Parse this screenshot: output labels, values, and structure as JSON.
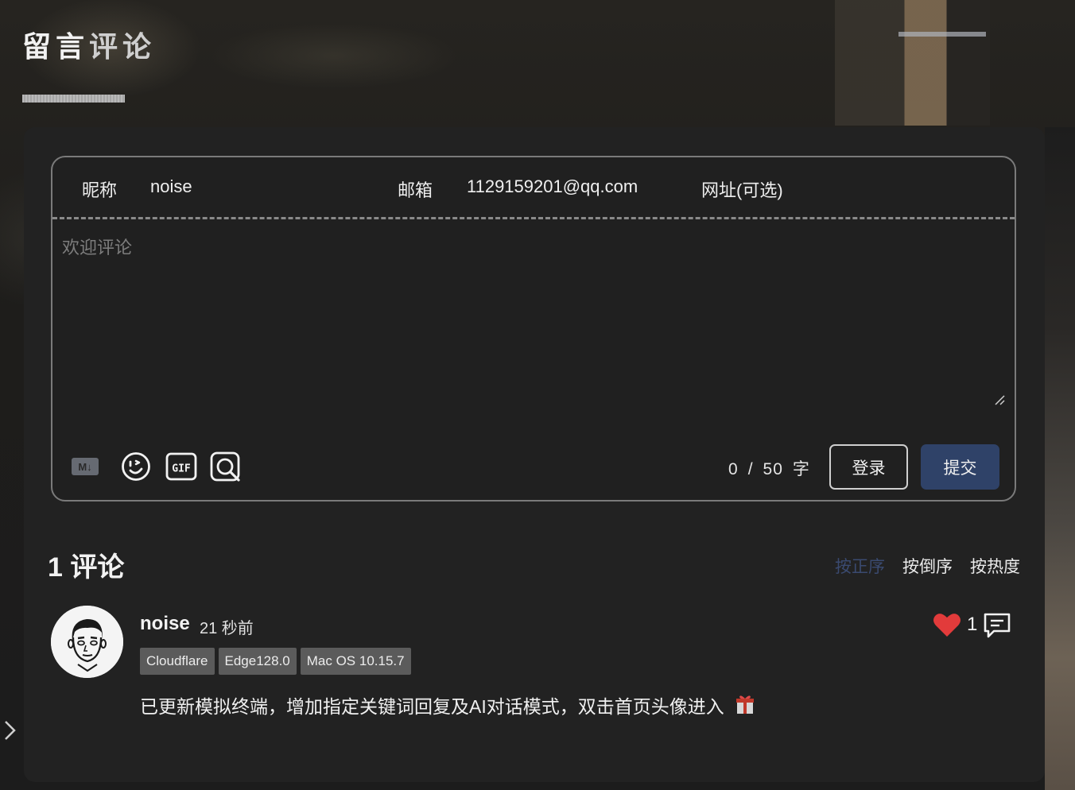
{
  "page": {
    "title_strong": "留言",
    "title_dim": "评论"
  },
  "form": {
    "nick_label": "昵称",
    "nick_value": "noise",
    "mail_label": "邮箱",
    "mail_value": "1129159201@qq.com",
    "url_label": "网址(可选)",
    "textarea_placeholder": "欢迎评论",
    "toolbar": {
      "markdown_icon_text": "M↓",
      "icons": [
        "markdown-icon",
        "emoji-icon",
        "gif-icon",
        "image-search-icon"
      ]
    },
    "word_count": {
      "current": "0",
      "separator": "/",
      "max": "50",
      "unit": "字"
    },
    "login_label": "登录",
    "submit_label": "提交",
    "submit_color": "#2f4268"
  },
  "comments": {
    "count_label": "1 评论",
    "sort": [
      "按正序",
      "按倒序",
      "按热度"
    ],
    "active_sort_color": "#3a4a70",
    "items": [
      {
        "author": "noise",
        "time": "21 秒前",
        "tags": [
          "Cloudflare",
          "Edge128.0",
          "Mac OS 10.15.7"
        ],
        "text": "已更新模拟终端，增加指定关键词回复及AI对话模式，双击首页头像进入",
        "likes": "1",
        "like_color": "#e23b3b"
      }
    ]
  }
}
